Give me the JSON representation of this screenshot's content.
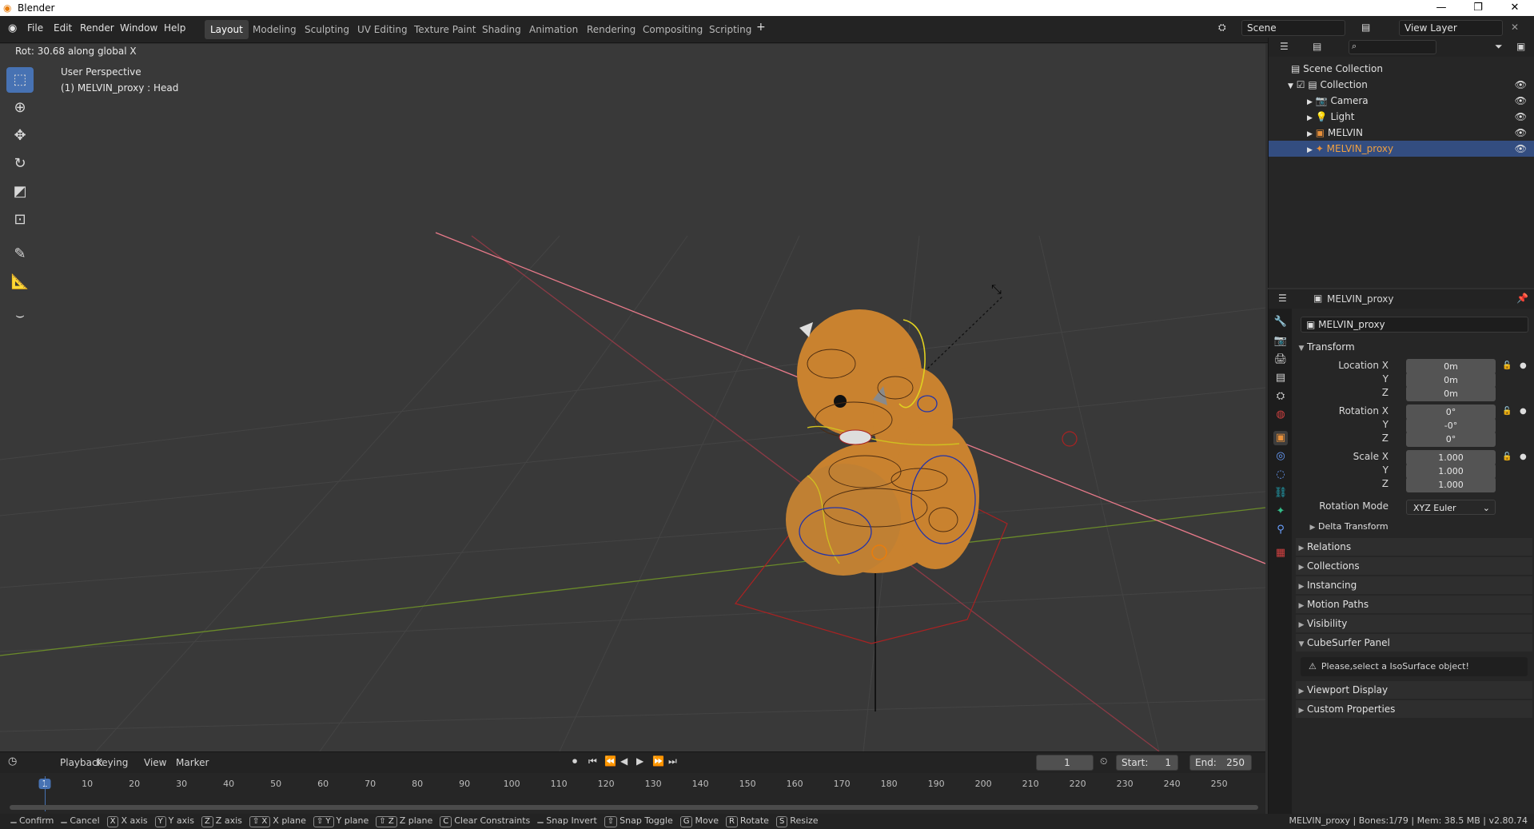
{
  "window": {
    "title": "Blender",
    "minimize": "—",
    "maximize": "❐",
    "close": "✕"
  },
  "menu": [
    "File",
    "Edit",
    "Render",
    "Window",
    "Help"
  ],
  "workspaces": [
    "Layout",
    "Modeling",
    "Sculpting",
    "UV Editing",
    "Texture Paint",
    "Shading",
    "Animation",
    "Rendering",
    "Compositing",
    "Scripting"
  ],
  "add_workspace": "+",
  "scene_field": "Scene",
  "view_layer_field": "View Layer",
  "viewport": {
    "operator_text": "Rot: 30.68 along global X",
    "view_name": "User Perspective",
    "object_info": "(1) MELVIN_proxy : Head"
  },
  "timeline": {
    "menus": [
      "Playback",
      "Keying",
      "View",
      "Marker"
    ],
    "current_frame": "1",
    "start_label": "Start:",
    "start": "1",
    "end_label": "End:",
    "end": "250",
    "ticks": [
      "1",
      "10",
      "20",
      "30",
      "40",
      "50",
      "60",
      "70",
      "80",
      "90",
      "100",
      "110",
      "120",
      "130",
      "140",
      "150",
      "160",
      "170",
      "180",
      "190",
      "200",
      "210",
      "220",
      "230",
      "240",
      "250"
    ]
  },
  "outliner": {
    "search_placeholder": "",
    "scene_collection": "Scene Collection",
    "items": [
      "Collection",
      "Camera",
      "Light",
      "MELVIN",
      "MELVIN_proxy"
    ]
  },
  "properties": {
    "header_object": "MELVIN_proxy",
    "object_name": "MELVIN_proxy",
    "transform_title": "Transform",
    "location_label": "Location X",
    "y": "Y",
    "z": "Z",
    "loc": [
      "0m",
      "0m",
      "0m"
    ],
    "rotation_label": "Rotation X",
    "rot": [
      "0°",
      "-0°",
      "0°"
    ],
    "scale_label": "Scale X",
    "scale": [
      "1.000",
      "1.000",
      "1.000"
    ],
    "rotation_mode_label": "Rotation Mode",
    "rotation_mode": "XYZ Euler",
    "delta": "Delta Transform",
    "panels": [
      "Relations",
      "Collections",
      "Instancing",
      "Motion Paths",
      "Visibility",
      "CubeSurfer Panel"
    ],
    "warning": "Please,select a IsoSurface object!",
    "panels2": [
      "Viewport Display",
      "Custom Properties"
    ]
  },
  "status": {
    "items": [
      [
        "",
        "Confirm"
      ],
      [
        "",
        "Cancel"
      ],
      [
        "X",
        "X axis"
      ],
      [
        "Y",
        "Y axis"
      ],
      [
        "Z",
        "Z axis"
      ],
      [
        "⇧ X",
        "X plane"
      ],
      [
        "⇧ Y",
        "Y plane"
      ],
      [
        "⇧ Z",
        "Z plane"
      ],
      [
        "C",
        "Clear Constraints"
      ],
      [
        "",
        "Snap Invert"
      ],
      [
        "⇧",
        "Snap Toggle"
      ],
      [
        "G",
        "Move"
      ],
      [
        "R",
        "Rotate"
      ],
      [
        "S",
        "Resize"
      ]
    ],
    "right": "MELVIN_proxy | Bones:1/79 | Mem: 38.5 MB | v2.80.74"
  }
}
